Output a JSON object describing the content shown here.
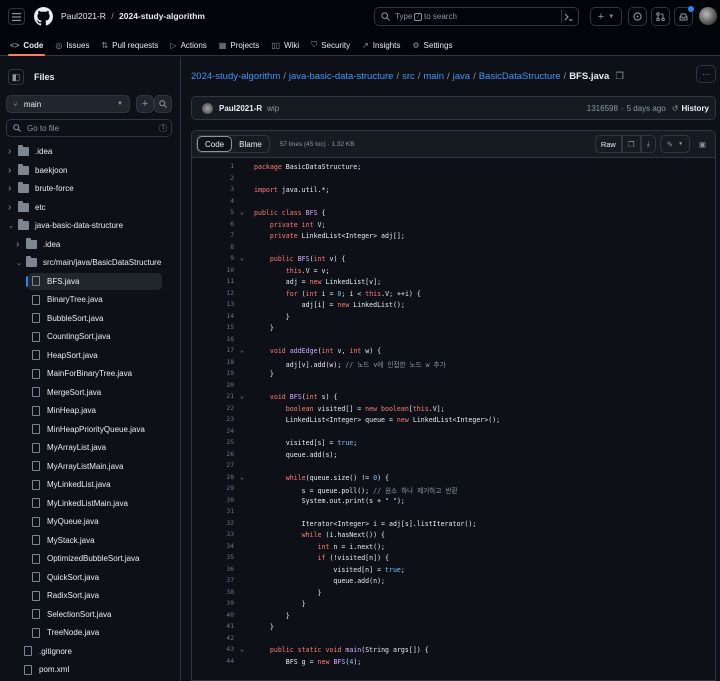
{
  "header": {
    "owner": "Paul2021-R",
    "separator": "/",
    "repo": "2024-study-algorithm",
    "search_prefix": "Type",
    "search_key": "/",
    "search_suffix": "to search"
  },
  "nav": [
    {
      "label": "Code",
      "icon": "code-icon"
    },
    {
      "label": "Issues",
      "icon": "issue-icon"
    },
    {
      "label": "Pull requests",
      "icon": "pull-request-icon"
    },
    {
      "label": "Actions",
      "icon": "actions-icon"
    },
    {
      "label": "Projects",
      "icon": "projects-icon"
    },
    {
      "label": "Wiki",
      "icon": "wiki-icon"
    },
    {
      "label": "Security",
      "icon": "shield-icon"
    },
    {
      "label": "Insights",
      "icon": "graph-icon"
    },
    {
      "label": "Settings",
      "icon": "gear-icon"
    }
  ],
  "sidebar": {
    "title": "Files",
    "branch": "main",
    "goto_placeholder": "Go to file",
    "goto_key": "t",
    "tree": [
      {
        "label": ".idea",
        "type": "folder",
        "depth": 0,
        "expanded": false
      },
      {
        "label": "baekjoon",
        "type": "folder",
        "depth": 0,
        "expanded": false
      },
      {
        "label": "brute-force",
        "type": "folder",
        "depth": 0,
        "expanded": false
      },
      {
        "label": "etc",
        "type": "folder",
        "depth": 0,
        "expanded": false
      },
      {
        "label": "java-basic-data-structure",
        "type": "folder",
        "depth": 0,
        "expanded": true
      },
      {
        "label": ".idea",
        "type": "folder",
        "depth": 1,
        "expanded": false
      },
      {
        "label": "src/main/java/BasicDataStructure",
        "type": "folder",
        "depth": 1,
        "expanded": true
      },
      {
        "label": "BFS.java",
        "type": "file",
        "depth": 2,
        "selected": true
      },
      {
        "label": "BinaryTree.java",
        "type": "file",
        "depth": 2
      },
      {
        "label": "BubbleSort.java",
        "type": "file",
        "depth": 2
      },
      {
        "label": "CountingSort.java",
        "type": "file",
        "depth": 2
      },
      {
        "label": "HeapSort.java",
        "type": "file",
        "depth": 2
      },
      {
        "label": "MainForBinaryTree.java",
        "type": "file",
        "depth": 2
      },
      {
        "label": "MergeSort.java",
        "type": "file",
        "depth": 2
      },
      {
        "label": "MinHeap.java",
        "type": "file",
        "depth": 2
      },
      {
        "label": "MinHeapPriorityQueue.java",
        "type": "file",
        "depth": 2
      },
      {
        "label": "MyArrayList.java",
        "type": "file",
        "depth": 2
      },
      {
        "label": "MyArrayListMain.java",
        "type": "file",
        "depth": 2
      },
      {
        "label": "MyLinkedList.java",
        "type": "file",
        "depth": 2
      },
      {
        "label": "MyLinkedListMain.java",
        "type": "file",
        "depth": 2
      },
      {
        "label": "MyQueue.java",
        "type": "file",
        "depth": 2
      },
      {
        "label": "MyStack.java",
        "type": "file",
        "depth": 2
      },
      {
        "label": "OptimizedBubbleSort.java",
        "type": "file",
        "depth": 2
      },
      {
        "label": "QuickSort.java",
        "type": "file",
        "depth": 2
      },
      {
        "label": "RadixSort.java",
        "type": "file",
        "depth": 2
      },
      {
        "label": "SelectionSort.java",
        "type": "file",
        "depth": 2
      },
      {
        "label": "TreeNode.java",
        "type": "file",
        "depth": 2
      },
      {
        "label": ".gitignore",
        "type": "file",
        "depth": 1
      },
      {
        "label": "pom.xml",
        "type": "file",
        "depth": 1
      }
    ]
  },
  "breadcrumb": [
    "2024-study-algorithm",
    "java-basic-data-structure",
    "src",
    "main",
    "java",
    "BasicDataStructure"
  ],
  "filename": "BFS.java",
  "commit": {
    "author": "Paul2021-R",
    "message": "wip",
    "hash": "1316598",
    "dot": "·",
    "time": "5 days ago",
    "history_label": "History"
  },
  "fileview": {
    "tab_code": "Code",
    "tab_blame": "Blame",
    "info": "57 lines (45 loc) · 1.32 KB",
    "raw_label": "Raw"
  },
  "code": [
    {
      "n": 1,
      "html": "<span class='kw'>package</span> BasicDataStructure;"
    },
    {
      "n": 2,
      "html": ""
    },
    {
      "n": 3,
      "html": "<span class='kw'>import</span> java.util.*;"
    },
    {
      "n": 4,
      "html": ""
    },
    {
      "n": 5,
      "html": "<span class='kw'>public class</span> <span class='fn'>BFS</span> {",
      "fold": true
    },
    {
      "n": 6,
      "html": "    <span class='kw'>private int</span> V;"
    },
    {
      "n": 7,
      "html": "    <span class='kw'>private</span> LinkedList&lt;Integer&gt; adj[];"
    },
    {
      "n": 8,
      "html": ""
    },
    {
      "n": 9,
      "html": "    <span class='kw'>public</span> <span class='fn'>BFS</span>(<span class='kw'>int</span> v) {",
      "fold": true
    },
    {
      "n": 10,
      "html": "        <span class='kw'>this</span>.V = v;"
    },
    {
      "n": 11,
      "html": "        adj = <span class='kw'>new</span> LinkedList[v];"
    },
    {
      "n": 12,
      "html": "        <span class='kw'>for</span> (<span class='kw'>int</span> i = <span class='nm'>0</span>; i &lt; <span class='kw'>this</span>.V; ++i) {"
    },
    {
      "n": 13,
      "html": "            adj[i] = <span class='kw'>new</span> LinkedList();"
    },
    {
      "n": 14,
      "html": "        }"
    },
    {
      "n": 15,
      "html": "    }"
    },
    {
      "n": 16,
      "html": ""
    },
    {
      "n": 17,
      "html": "    <span class='kw'>void</span> <span class='fn'>addEdge</span>(<span class='kw'>int</span> v, <span class='kw'>int</span> w) {",
      "fold": true
    },
    {
      "n": 18,
      "html": "        adj[v].add(w); <span class='cm'>// 노드 v에 인접한 노드 w 추가</span>"
    },
    {
      "n": 19,
      "html": "    }"
    },
    {
      "n": 20,
      "html": ""
    },
    {
      "n": 21,
      "html": "    <span class='kw'>void</span> <span class='fn'>BFS</span>(<span class='kw'>int</span> s) {",
      "fold": true
    },
    {
      "n": 22,
      "html": "        <span class='kw'>boolean</span> visited[] = <span class='kw'>new boolean</span>[<span class='kw'>this</span>.V];"
    },
    {
      "n": 23,
      "html": "        LinkedList&lt;Integer&gt; queue = <span class='kw'>new</span> LinkedList&lt;Integer&gt;();"
    },
    {
      "n": 24,
      "html": ""
    },
    {
      "n": 25,
      "html": "        visited[s] = <span class='nm'>true</span>;"
    },
    {
      "n": 26,
      "html": "        queue.add(s);"
    },
    {
      "n": 27,
      "html": ""
    },
    {
      "n": 28,
      "html": "        <span class='kw'>while</span>(queue.size() != <span class='nm'>0</span>) {",
      "fold": true
    },
    {
      "n": 29,
      "html": "            s = queue.poll(); <span class='cm'>// 원소 하나 제거하고 반환</span>"
    },
    {
      "n": 30,
      "html": "            System.out.print(s + <span class='st'>\" \"</span>);"
    },
    {
      "n": 31,
      "html": ""
    },
    {
      "n": 32,
      "html": "            Iterator&lt;Integer&gt; i = adj[s].listIterator();"
    },
    {
      "n": 33,
      "html": "            <span class='kw'>while</span> (i.hasNext()) {"
    },
    {
      "n": 34,
      "html": "                <span class='kw'>int</span> n = i.next();"
    },
    {
      "n": 35,
      "html": "                <span class='kw'>if</span> (!visited[n]) {"
    },
    {
      "n": 36,
      "html": "                    visited[n] = <span class='nm'>true</span>;"
    },
    {
      "n": 37,
      "html": "                    queue.add(n);"
    },
    {
      "n": 38,
      "html": "                }"
    },
    {
      "n": 39,
      "html": "            }"
    },
    {
      "n": 40,
      "html": "        }"
    },
    {
      "n": 41,
      "html": "    }"
    },
    {
      "n": 42,
      "html": ""
    },
    {
      "n": 43,
      "html": "    <span class='kw'>public static void</span> <span class='fn'>main</span>(String args[]) {",
      "fold": true
    },
    {
      "n": 44,
      "html": "        BFS g = <span class='kw'>new</span> <span class='fn'>BFS</span>(<span class='nm'>4</span>);"
    }
  ]
}
